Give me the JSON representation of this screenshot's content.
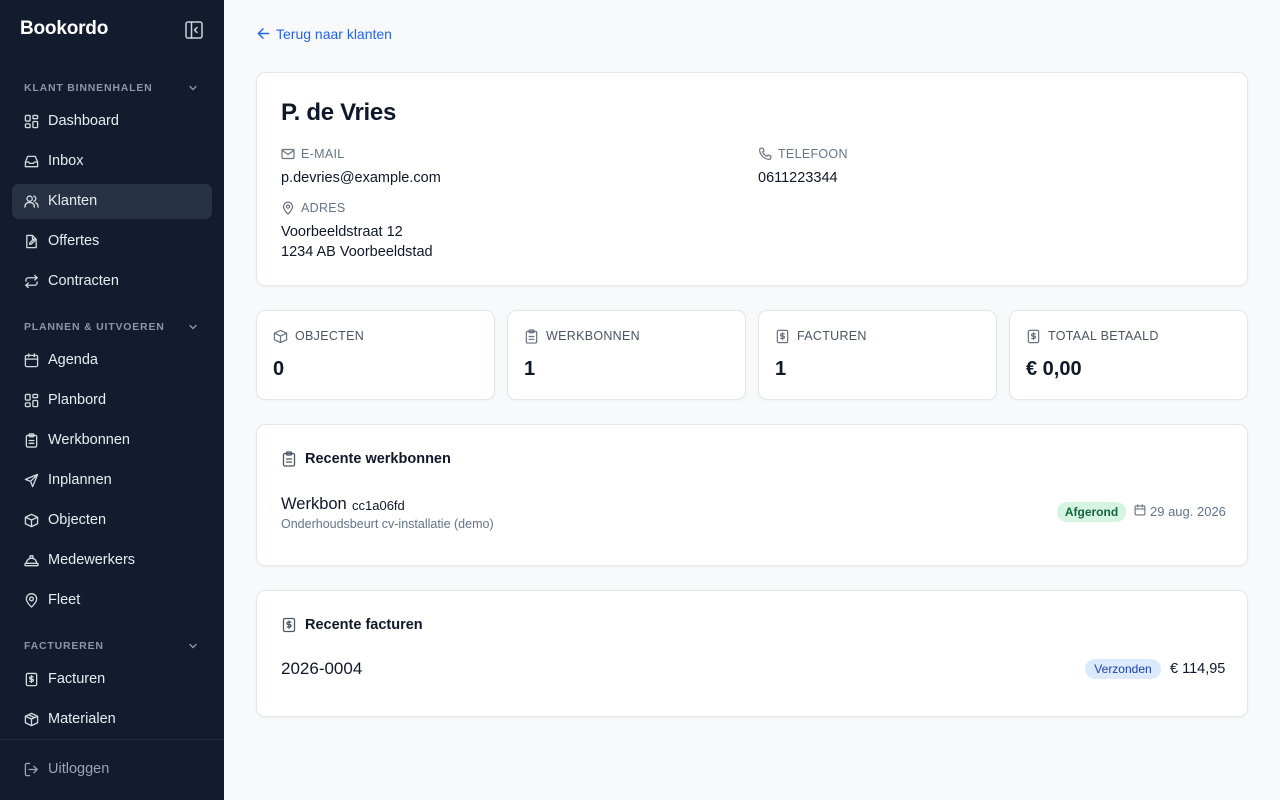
{
  "app": {
    "brand": "Bookordo"
  },
  "sidebar": {
    "sections": [
      {
        "title": "KLANT BINNENHALEN"
      },
      {
        "title": "PLANNEN & UITVOEREN"
      },
      {
        "title": "FACTUREREN"
      }
    ],
    "items": [
      {
        "label": "Dashboard",
        "icon": "grid-icon"
      },
      {
        "label": "Inbox",
        "icon": "inbox-icon"
      },
      {
        "label": "Klanten",
        "icon": "users-icon",
        "active": true
      },
      {
        "label": "Offertes",
        "icon": "file-edit-icon"
      },
      {
        "label": "Contracten",
        "icon": "repeat-icon"
      },
      {
        "label": "Agenda",
        "icon": "calendar-icon"
      },
      {
        "label": "Planbord",
        "icon": "grid-icon"
      },
      {
        "label": "Werkbonnen",
        "icon": "clipboard-icon"
      },
      {
        "label": "Inplannen",
        "icon": "send-icon"
      },
      {
        "label": "Objecten",
        "icon": "box-icon"
      },
      {
        "label": "Medewerkers",
        "icon": "hard-hat-icon"
      },
      {
        "label": "Fleet",
        "icon": "map-pin-icon"
      },
      {
        "label": "Facturen",
        "icon": "invoice-icon"
      },
      {
        "label": "Materialen",
        "icon": "package-icon"
      }
    ],
    "logout": "Uitloggen"
  },
  "main": {
    "back_link": "Terug naar klanten",
    "customer": {
      "name": "P. de Vries",
      "email_label": "E-MAIL",
      "email": "p.devries@example.com",
      "phone_label": "TELEFOON",
      "phone": "0611223344",
      "address_label": "ADRES",
      "address_line1": "Voorbeeldstraat 12",
      "address_line2": "1234 AB Voorbeeldstad"
    },
    "stats": [
      {
        "label": "OBJECTEN",
        "value": "0",
        "icon": "box-icon"
      },
      {
        "label": "WERKBONNEN",
        "value": "1",
        "icon": "clipboard-icon"
      },
      {
        "label": "FACTUREN",
        "value": "1",
        "icon": "invoice-icon"
      },
      {
        "label": "TOTAAL BETAALD",
        "value": "€ 0,00",
        "icon": "invoice-icon"
      }
    ],
    "recent_workorders": {
      "title": "Recente werkbonnen",
      "items": [
        {
          "title": "Werkbon",
          "code": "cc1a06fd",
          "description": "Onderhoudsbeurt cv-installatie (demo)",
          "status": "Afgerond",
          "date": "29 aug. 2026"
        }
      ]
    },
    "recent_invoices": {
      "title": "Recente facturen",
      "items": [
        {
          "number": "2026-0004",
          "status": "Verzonden",
          "amount": "€ 114,95"
        }
      ]
    }
  },
  "colors": {
    "sidebar_bg": "#131c2e",
    "sidebar_active": "#273244",
    "accent_link": "#2563eb",
    "status_done_bg": "#d5f5e2",
    "status_done_text": "#14653d",
    "status_sent_bg": "#dbeafe",
    "status_sent_text": "#1e40af"
  }
}
